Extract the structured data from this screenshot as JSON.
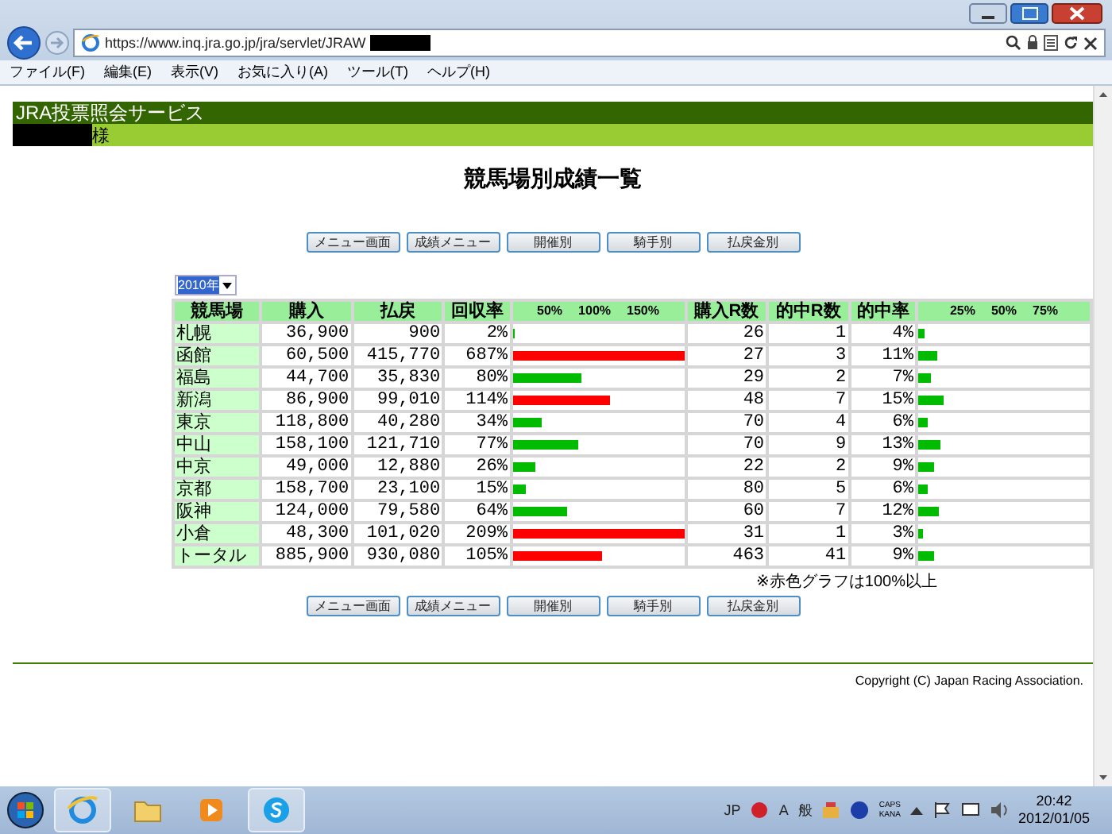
{
  "browser": {
    "url": "https://www.inq.jra.go.jp/jra/servlet/JRAW",
    "menu": [
      "ファイル(F)",
      "編集(E)",
      "表示(V)",
      "お気に入り(A)",
      "ツール(T)",
      "ヘルプ(H)"
    ]
  },
  "page": {
    "service_title": "JRA投票照会サービス",
    "user_suffix": "様",
    "heading": "競馬場別成績一覧",
    "nav_buttons_top": [
      "メニュー画面",
      "成績メニュー",
      "開催別",
      "騎手別",
      "払戻金別"
    ],
    "year_select": "2010年",
    "table": {
      "columns": [
        "競馬場",
        "購入",
        "払戻",
        "回収率",
        "購入R数",
        "的中R数",
        "的中率"
      ],
      "recovery_ticks": [
        "50%",
        "100%",
        "150%"
      ],
      "hit_ticks": [
        "25%",
        "50%",
        "75%"
      ],
      "rows": [
        {
          "venue": "札幌",
          "purchase": "36,900",
          "payout": "900",
          "recovery": "2%",
          "recovery_bar": {
            "level": 0.01,
            "color": "#00bb00"
          },
          "races": "26",
          "hits": "1",
          "hit_rate": "4%",
          "hit_bar": {
            "level": 0.04
          }
        },
        {
          "venue": "函館",
          "purchase": "60,500",
          "payout": "415,770",
          "recovery": "687%",
          "recovery_bar": {
            "level": 1,
            "color": "#ff0000"
          },
          "races": "27",
          "hits": "3",
          "hit_rate": "11%",
          "hit_bar": {
            "level": 0.11
          }
        },
        {
          "venue": "福島",
          "purchase": "44,700",
          "payout": "35,830",
          "recovery": "80%",
          "recovery_bar": {
            "level": 0.4,
            "color": "#00bb00"
          },
          "races": "29",
          "hits": "2",
          "hit_rate": "7%",
          "hit_bar": {
            "level": 0.07
          }
        },
        {
          "venue": "新潟",
          "purchase": "86,900",
          "payout": "99,010",
          "recovery": "114%",
          "recovery_bar": {
            "level": 0.57,
            "color": "#ff0000"
          },
          "races": "48",
          "hits": "7",
          "hit_rate": "15%",
          "hit_bar": {
            "level": 0.15
          }
        },
        {
          "venue": "東京",
          "purchase": "118,800",
          "payout": "40,280",
          "recovery": "34%",
          "recovery_bar": {
            "level": 0.17,
            "color": "#00bb00"
          },
          "races": "70",
          "hits": "4",
          "hit_rate": "6%",
          "hit_bar": {
            "level": 0.06
          }
        },
        {
          "venue": "中山",
          "purchase": "158,100",
          "payout": "121,710",
          "recovery": "77%",
          "recovery_bar": {
            "level": 0.385,
            "color": "#00bb00"
          },
          "races": "70",
          "hits": "9",
          "hit_rate": "13%",
          "hit_bar": {
            "level": 0.13
          }
        },
        {
          "venue": "中京",
          "purchase": "49,000",
          "payout": "12,880",
          "recovery": "26%",
          "recovery_bar": {
            "level": 0.13,
            "color": "#00bb00"
          },
          "races": "22",
          "hits": "2",
          "hit_rate": "9%",
          "hit_bar": {
            "level": 0.09
          }
        },
        {
          "venue": "京都",
          "purchase": "158,700",
          "payout": "23,100",
          "recovery": "15%",
          "recovery_bar": {
            "level": 0.075,
            "color": "#00bb00"
          },
          "races": "80",
          "hits": "5",
          "hit_rate": "6%",
          "hit_bar": {
            "level": 0.06
          }
        },
        {
          "venue": "阪神",
          "purchase": "124,000",
          "payout": "79,580",
          "recovery": "64%",
          "recovery_bar": {
            "level": 0.32,
            "color": "#00bb00"
          },
          "races": "60",
          "hits": "7",
          "hit_rate": "12%",
          "hit_bar": {
            "level": 0.12
          }
        },
        {
          "venue": "小倉",
          "purchase": "48,300",
          "payout": "101,020",
          "recovery": "209%",
          "recovery_bar": {
            "level": 1,
            "color": "#ff0000"
          },
          "races": "31",
          "hits": "1",
          "hit_rate": "3%",
          "hit_bar": {
            "level": 0.03
          }
        },
        {
          "venue": "トータル",
          "purchase": "885,900",
          "payout": "930,080",
          "recovery": "105%",
          "recovery_bar": {
            "level": 0.525,
            "color": "#ff0000"
          },
          "races": "463",
          "hits": "41",
          "hit_rate": "9%",
          "hit_bar": {
            "level": 0.09
          }
        }
      ]
    },
    "note": "※赤色グラフは100%以上",
    "nav_buttons_bottom": [
      "メニュー画面",
      "成績メニュー",
      "開催別",
      "騎手別",
      "払戻金別"
    ],
    "copyright": "Copyright (C) Japan Racing Association."
  },
  "taskbar": {
    "tray": {
      "language": "JP",
      "ime_mode": "A",
      "ime_kanji": "般",
      "caps": "CAPS",
      "kana": "KANA"
    },
    "time": "20:42",
    "date": "2012/01/05"
  }
}
